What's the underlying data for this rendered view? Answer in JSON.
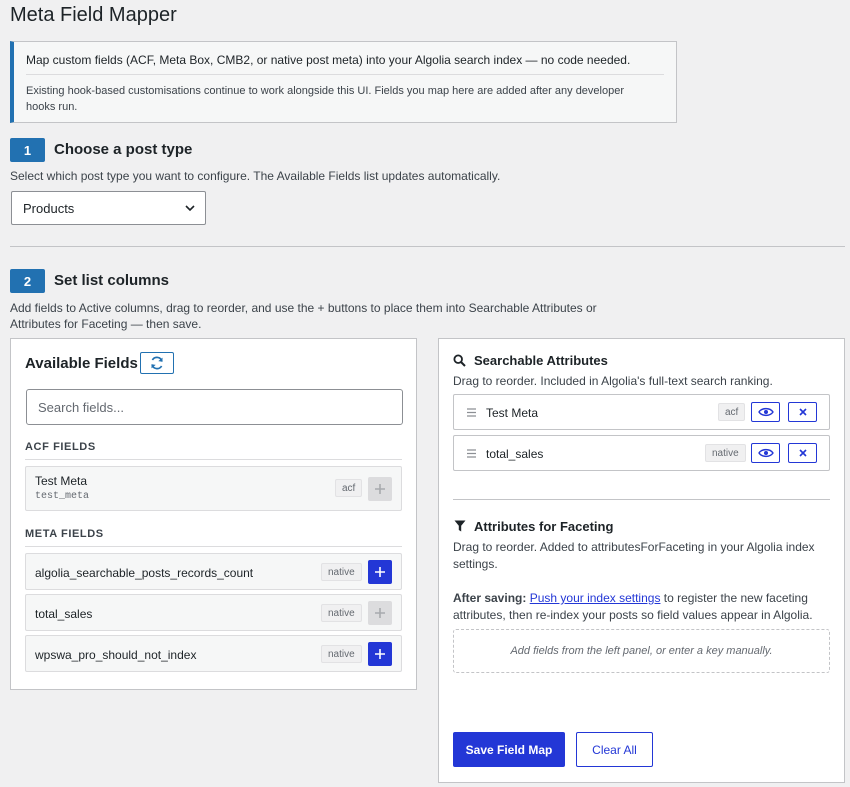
{
  "page": {
    "title": "Meta Field Mapper"
  },
  "notice": {
    "line1": "Map custom fields (ACF, Meta Box, CMB2, or native post meta) into your Algolia search index — no code needed.",
    "line2": "Existing hook-based customisations continue to work alongside this UI. Fields you map here are added after any developer hooks run."
  },
  "step1": {
    "number": "1",
    "title": "Choose a post type",
    "description": "Select which post type you want to configure. The Available Fields list updates automatically.",
    "post_type_value": "Products"
  },
  "step2": {
    "number": "2",
    "title": "Set list columns",
    "description": "Add fields to Active columns, drag to reorder, and use the + buttons to place them into Searchable Attributes or Attributes for Faceting — then save."
  },
  "available": {
    "title": "Available Fields",
    "search_placeholder": "Search fields...",
    "acf_label": "ACF FIELDS",
    "acf_fields": [
      {
        "name": "Test Meta",
        "key": "test_meta",
        "source": "acf"
      }
    ],
    "meta_label": "META FIELDS",
    "meta_fields": [
      {
        "name": "algolia_searchable_posts_records_count",
        "source": "native"
      },
      {
        "name": "total_sales",
        "source": "native"
      },
      {
        "name": "wpswa_pro_should_not_index",
        "source": "native"
      }
    ]
  },
  "searchable": {
    "title": "Searchable Attributes",
    "description": "Drag to reorder. Included in Algolia's full-text search ranking.",
    "items": [
      {
        "name": "Test Meta",
        "source": "acf"
      },
      {
        "name": "total_sales",
        "source": "native"
      }
    ]
  },
  "faceting": {
    "title": "Attributes for Faceting",
    "description": "Drag to reorder. Added to attributesForFaceting in your Algolia index settings.",
    "after_label": "After saving:",
    "after_link": "Push your index settings",
    "after_text": " to register the new faceting attributes, then re-index your posts so field values appear in Algolia.",
    "empty_text": "Add fields from the left panel, or enter a key manually."
  },
  "actions": {
    "save_label": "Save Field Map",
    "clear_label": "Clear All"
  },
  "colors": {
    "accent": "#2271b1",
    "button": "#2337d6"
  }
}
